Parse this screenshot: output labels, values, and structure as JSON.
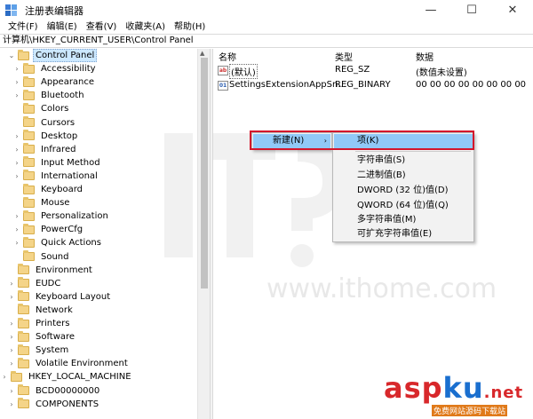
{
  "window": {
    "title": "注册表编辑器",
    "controls": {
      "minimize": "—",
      "maximize": "☐",
      "close": "✕"
    }
  },
  "menubar": [
    "文件(F)",
    "编辑(E)",
    "查看(V)",
    "收藏夹(A)",
    "帮助(H)"
  ],
  "address": "计算机\\HKEY_CURRENT_USER\\Control Panel",
  "tree": [
    {
      "label": "Control Panel",
      "level": 0,
      "expanded": true,
      "selected": true
    },
    {
      "label": "Accessibility",
      "level": 1,
      "expandable": true
    },
    {
      "label": "Appearance",
      "level": 1,
      "expandable": true
    },
    {
      "label": "Bluetooth",
      "level": 1,
      "expandable": true
    },
    {
      "label": "Colors",
      "level": 1,
      "expandable": false
    },
    {
      "label": "Cursors",
      "level": 1,
      "expandable": false
    },
    {
      "label": "Desktop",
      "level": 1,
      "expandable": true
    },
    {
      "label": "Infrared",
      "level": 1,
      "expandable": true
    },
    {
      "label": "Input Method",
      "level": 1,
      "expandable": true
    },
    {
      "label": "International",
      "level": 1,
      "expandable": true
    },
    {
      "label": "Keyboard",
      "level": 1,
      "expandable": false
    },
    {
      "label": "Mouse",
      "level": 1,
      "expandable": false
    },
    {
      "label": "Personalization",
      "level": 1,
      "expandable": true
    },
    {
      "label": "PowerCfg",
      "level": 1,
      "expandable": true
    },
    {
      "label": "Quick Actions",
      "level": 1,
      "expandable": true
    },
    {
      "label": "Sound",
      "level": 1,
      "expandable": false
    },
    {
      "label": "Environment",
      "level": 0,
      "expandable": false
    },
    {
      "label": "EUDC",
      "level": 0,
      "expandable": true
    },
    {
      "label": "Keyboard Layout",
      "level": 0,
      "expandable": true
    },
    {
      "label": "Network",
      "level": 0,
      "expandable": false
    },
    {
      "label": "Printers",
      "level": 0,
      "expandable": true
    },
    {
      "label": "Software",
      "level": 0,
      "expandable": true
    },
    {
      "label": "System",
      "level": 0,
      "expandable": true
    },
    {
      "label": "Volatile Environment",
      "level": 0,
      "expandable": true
    },
    {
      "label": "HKEY_LOCAL_MACHINE",
      "level": -1,
      "expandable": true
    },
    {
      "label": "BCD00000000",
      "level": 0,
      "expandable": true
    },
    {
      "label": "COMPONENTS",
      "level": 0,
      "expandable": true
    }
  ],
  "values": {
    "columns": {
      "name": "名称",
      "type": "类型",
      "data": "数据"
    },
    "rows": [
      {
        "name": "(默认)",
        "type": "REG_SZ",
        "data": "(数值未设置)",
        "icon": "string-value-icon"
      },
      {
        "name": "SettingsExtensionAppSn...",
        "type": "REG_BINARY",
        "data": "00 00 00 00 00 00 00 00",
        "icon": "binary-value-icon"
      }
    ]
  },
  "context_menu": {
    "new_label": "新建(N)",
    "submenu": [
      "项(K)",
      "字符串值(S)",
      "二进制值(B)",
      "DWORD (32 位)值(D)",
      "QWORD (64 位)值(Q)",
      "多字符串值(M)",
      "可扩充字符串值(E)"
    ]
  },
  "watermark": {
    "site": "www.ithome.com",
    "asp_a": "asp",
    "asp_b": "ku",
    "asp_c": ".net",
    "asp_sub": "免费网站源码下载站"
  },
  "colors": {
    "highlight": "#91c9f7",
    "red_outline": "#d4152b",
    "selection": "#cce8ff"
  }
}
